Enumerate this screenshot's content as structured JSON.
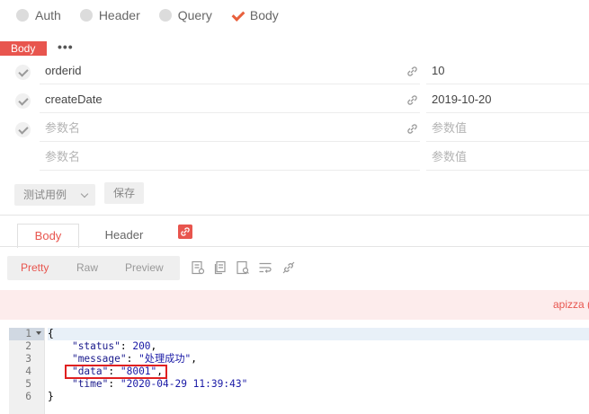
{
  "request_tabs": [
    {
      "label": "Auth",
      "checked": false
    },
    {
      "label": "Header",
      "checked": false
    },
    {
      "label": "Query",
      "checked": false
    },
    {
      "label": "Body",
      "checked": true
    }
  ],
  "body_section": {
    "tag": "Body",
    "more": "•••"
  },
  "params": [
    {
      "name": "orderid",
      "value": "10",
      "enabled": true
    },
    {
      "name": "createDate",
      "value": "2019-10-20",
      "enabled": true
    },
    {
      "name_placeholder": "参数名",
      "value_placeholder": "参数值",
      "enabled": true
    },
    {
      "name_placeholder": "参数名",
      "value_placeholder": "参数值",
      "enabled": false
    }
  ],
  "buttons": {
    "test_case": "测试用例",
    "save": "保存"
  },
  "response_tabs": {
    "body": "Body",
    "header": "Header"
  },
  "format_tabs": {
    "pretty": "Pretty",
    "raw": "Raw",
    "preview": "Preview",
    "active": "Pretty"
  },
  "alert": {
    "text": "apizza ("
  },
  "code": {
    "line_numbers": [
      "1",
      "2",
      "3",
      "4",
      "5",
      "6"
    ],
    "status_key": "\"status\"",
    "status_val": "200",
    "message_key": "\"message\"",
    "message_val": "\"处理成功\"",
    "data_key": "\"data\"",
    "data_val": "\"8001\"",
    "time_key": "\"time\"",
    "time_val": "\"2020-04-29 11:39:43\"",
    "open": "{",
    "close": "}"
  },
  "colors": {
    "accent": "#e8554e",
    "check": "#e8603c"
  }
}
